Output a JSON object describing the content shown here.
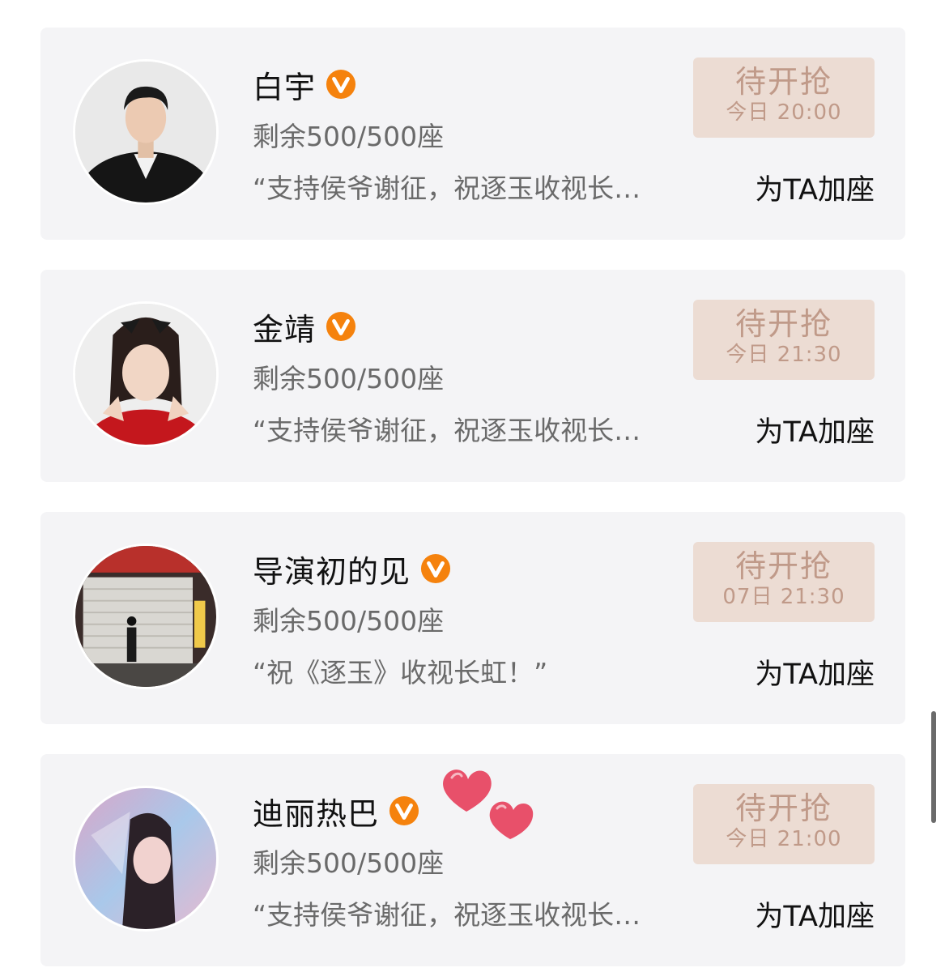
{
  "cards": [
    {
      "name": "白宇",
      "seats": "剩余500/500座",
      "quote": "“支持侯爷谢征，祝逐玉收视长…",
      "grab_title": "待开抢",
      "grab_time": "今日 20:00",
      "add_seat": "为TA加座",
      "verified_icon": "orange-v-badge"
    },
    {
      "name": "金靖",
      "seats": "剩余500/500座",
      "quote": "“支持侯爷谢征，祝逐玉收视长…",
      "grab_title": "待开抢",
      "grab_time": "今日 21:30",
      "add_seat": "为TA加座",
      "verified_icon": "orange-v-badge"
    },
    {
      "name": "导演初的见",
      "seats": "剩余500/500座",
      "quote": "“祝《逐玉》收视长虹！”",
      "grab_title": "待开抢",
      "grab_time": "07日 21:30",
      "add_seat": "为TA加座",
      "verified_icon": "orange-v-badge"
    },
    {
      "name": "迪丽热巴",
      "seats": "剩余500/500座",
      "quote": "“支持侯爷谢征，祝逐玉收视长…",
      "grab_title": "待开抢",
      "grab_time": "今日 21:00",
      "add_seat": "为TA加座",
      "verified_icon": "orange-v-badge"
    }
  ],
  "colors": {
    "card_bg": "#f4f4f6",
    "grab_bg": "#ecdcd3",
    "grab_text": "#c09a89",
    "badge": "#f5820d",
    "heart": "#e8506a"
  }
}
